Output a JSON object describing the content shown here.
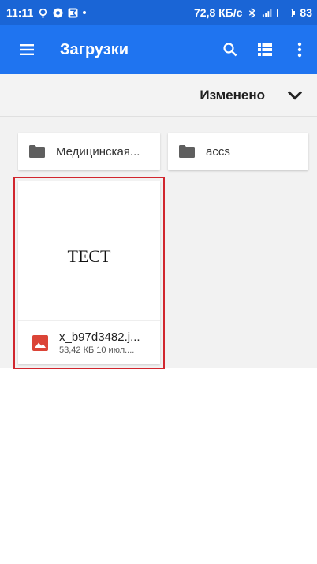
{
  "status_bar": {
    "time": "11:11",
    "speed": "72,8 КБ/с",
    "battery": "83",
    "battery_level": 0.83
  },
  "app_bar": {
    "title": "Загрузки",
    "icons": [
      "menu-icon",
      "search-icon",
      "list-view-icon",
      "more-vert-icon"
    ]
  },
  "sort": {
    "label": "Изменено",
    "icon": "chevron-down-icon"
  },
  "folders": [
    {
      "label": "Медицинская...",
      "icon": "folder-icon"
    },
    {
      "label": "accs",
      "icon": "folder-icon"
    }
  ],
  "file": {
    "thumbnail_text": "ТЕСТ",
    "name": "x_b97d3482.j...",
    "subtitle": "53,42 КБ 10 июл....",
    "icon": "image-file-icon",
    "icon_color": "#db4437"
  },
  "colors": {
    "status_bar": "#1a65d6",
    "app_bar": "#1f74f0",
    "highlight": "#d1262e"
  }
}
